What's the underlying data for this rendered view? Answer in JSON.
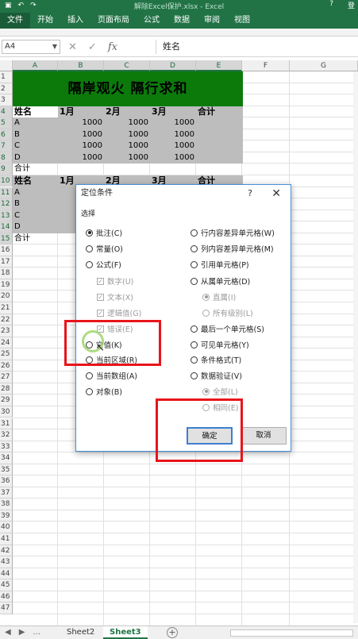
{
  "titlebar": {
    "title": "解除Excel保护.xlsx - Excel",
    "help": "?",
    "login": "登",
    "save_icon": "save-icon",
    "undo_icon": "undo-icon",
    "redo_icon": "redo-icon"
  },
  "ribbon": {
    "tabs": [
      "文件",
      "开始",
      "插入",
      "页面布局",
      "公式",
      "数据",
      "审阅",
      "视图"
    ]
  },
  "formula_bar": {
    "name_box": "A4",
    "formula": "姓名",
    "cancel": "✕",
    "enter": "✓",
    "fx": "fx"
  },
  "columns": [
    "A",
    "B",
    "C",
    "D",
    "E",
    "F",
    "G"
  ],
  "rows": [
    "1",
    "2",
    "3",
    "4",
    "5",
    "6",
    "7",
    "8",
    "9",
    "10",
    "11",
    "12",
    "13",
    "14",
    "15",
    "16",
    "17",
    "18",
    "19",
    "20",
    "21",
    "22",
    "23",
    "24",
    "25",
    "26",
    "27",
    "28",
    "29",
    "30",
    "31",
    "32",
    "33",
    "34",
    "35",
    "36",
    "37",
    "38",
    "39",
    "40",
    "41",
    "42",
    "43",
    "44",
    "45",
    "46",
    "47"
  ],
  "sheet": {
    "banner": "隔岸观火   隔行求和",
    "header1": [
      "姓名",
      "1月",
      "2月",
      "3月",
      "合计"
    ],
    "rows1": [
      [
        "A",
        "1000",
        "1000",
        "1000"
      ],
      [
        "B",
        "1000",
        "1000",
        "1000"
      ],
      [
        "C",
        "1000",
        "1000",
        "1000"
      ],
      [
        "D",
        "1000",
        "1000",
        "1000"
      ]
    ],
    "total1": "合计",
    "header2": [
      "姓名",
      "1月",
      "2月",
      "3月",
      "合计"
    ],
    "rows2": [
      "A",
      "B",
      "C",
      "D"
    ],
    "total2": "合计"
  },
  "dialog": {
    "title": "定位条件",
    "help": "?",
    "close": "✕",
    "section": "选择",
    "left_options": [
      {
        "label": "批注(C)",
        "checked": true,
        "disabled": false,
        "kind": "radio"
      },
      {
        "label": "常量(O)",
        "checked": false,
        "disabled": false,
        "kind": "radio"
      },
      {
        "label": "公式(F)",
        "checked": false,
        "disabled": false,
        "kind": "radio"
      },
      {
        "label": "数字(U)",
        "checked": true,
        "disabled": true,
        "kind": "check"
      },
      {
        "label": "文本(X)",
        "checked": true,
        "disabled": true,
        "kind": "check"
      },
      {
        "label": "逻辑值(G)",
        "checked": true,
        "disabled": true,
        "kind": "check"
      },
      {
        "label": "错误(E)",
        "checked": true,
        "disabled": true,
        "kind": "check"
      },
      {
        "label": "空值(K)",
        "checked": false,
        "disabled": false,
        "kind": "radio"
      },
      {
        "label": "当前区域(R)",
        "checked": false,
        "disabled": false,
        "kind": "radio"
      },
      {
        "label": "当前数组(A)",
        "checked": false,
        "disabled": false,
        "kind": "radio"
      },
      {
        "label": "对象(B)",
        "checked": false,
        "disabled": false,
        "kind": "radio"
      }
    ],
    "right_options": [
      {
        "label": "行内容差异单元格(W)",
        "checked": false,
        "disabled": false
      },
      {
        "label": "列内容差异单元格(M)",
        "checked": false,
        "disabled": false
      },
      {
        "label": "引用单元格(P)",
        "checked": false,
        "disabled": false
      },
      {
        "label": "从属单元格(D)",
        "checked": false,
        "disabled": false
      },
      {
        "label": "直属(I)",
        "checked": true,
        "disabled": true
      },
      {
        "label": "所有级别(L)",
        "checked": false,
        "disabled": true
      },
      {
        "label": "最后一个单元格(S)",
        "checked": false,
        "disabled": false
      },
      {
        "label": "可见单元格(Y)",
        "checked": false,
        "disabled": false
      },
      {
        "label": "条件格式(T)",
        "checked": false,
        "disabled": false
      },
      {
        "label": "数据验证(V)",
        "checked": false,
        "disabled": false
      },
      {
        "label": "全部(L)",
        "checked": true,
        "disabled": true
      },
      {
        "label": "相同(E)",
        "checked": false,
        "disabled": true
      }
    ],
    "ok": "确定",
    "cancel": "取消"
  },
  "sheet_tabs": {
    "nav_prev": "◀",
    "nav_next": "▶",
    "more": "...",
    "tabs": [
      "Sheet2",
      "Sheet3"
    ],
    "active": "Sheet3",
    "add": "+"
  },
  "colors": {
    "excel_green": "#217346",
    "banner_green": "#0b7a0b",
    "highlight_red": "#e8141b",
    "selection_gray": "#bdbdbd"
  }
}
